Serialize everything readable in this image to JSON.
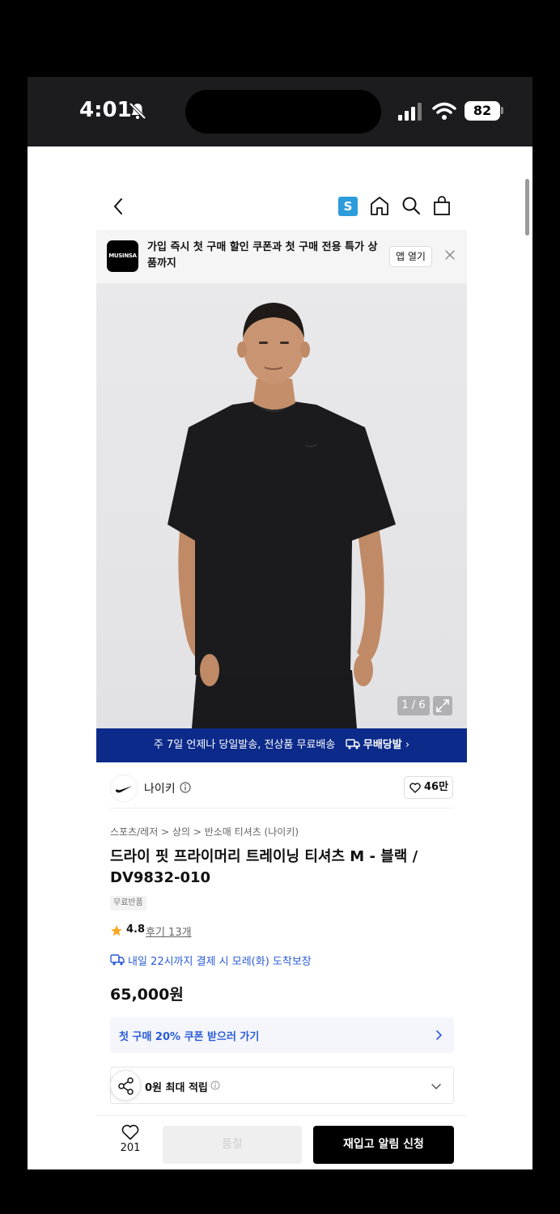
{
  "status_bar": {
    "time": "4:01",
    "battery": "82",
    "icons": [
      "bell-slash-icon",
      "signal-icon",
      "wifi-icon",
      "battery-icon"
    ]
  },
  "header": {
    "back_icon": "chevron-left-icon",
    "s_badge": "S",
    "icons": [
      "home-icon",
      "search-icon",
      "shopping-bag-icon"
    ]
  },
  "app_banner": {
    "logo_text": "MUSINSA",
    "text": "가입 즉시 첫 구매 할인 쿠폰과 첫 구매 전용 특가 상품까지",
    "open_button": "앱 열기",
    "close_icon": "close-icon"
  },
  "gallery": {
    "counter": "1 / 6",
    "expand_icon": "expand-icon"
  },
  "delivery_banner": {
    "text": "주 7일 언제나 당일발송, 전상품 무료배송",
    "badge": "무배당발",
    "chevron": "›"
  },
  "brand": {
    "name": "나이키",
    "likes": "46만"
  },
  "product": {
    "breadcrumb": "스포츠/레저 > 상의 > 반소매 티셔츠 (나이키)",
    "title": "드라이 핏 프라이머리 트레이닝 티셔츠 M - 블랙 / DV9832-010",
    "badge": "무료반품",
    "rating": "4.8",
    "reviews": "후기 13개",
    "arrival": "내일 22시까지 결제 시 모레(화) 도착보장",
    "price": "65,000원"
  },
  "coupon": {
    "label": "첫 구매 20% 쿠폰 받으러 가기"
  },
  "points": {
    "label": "0원 최대 적립"
  },
  "bottom_bar": {
    "wish_count": "201",
    "soldout_label": "품절",
    "restock_label": "재입고 알림 신청"
  },
  "colors": {
    "delivery_banner": "#0c2a8a",
    "accent_blue": "#2a5bd7",
    "s_badge": "#2d9cdb"
  }
}
